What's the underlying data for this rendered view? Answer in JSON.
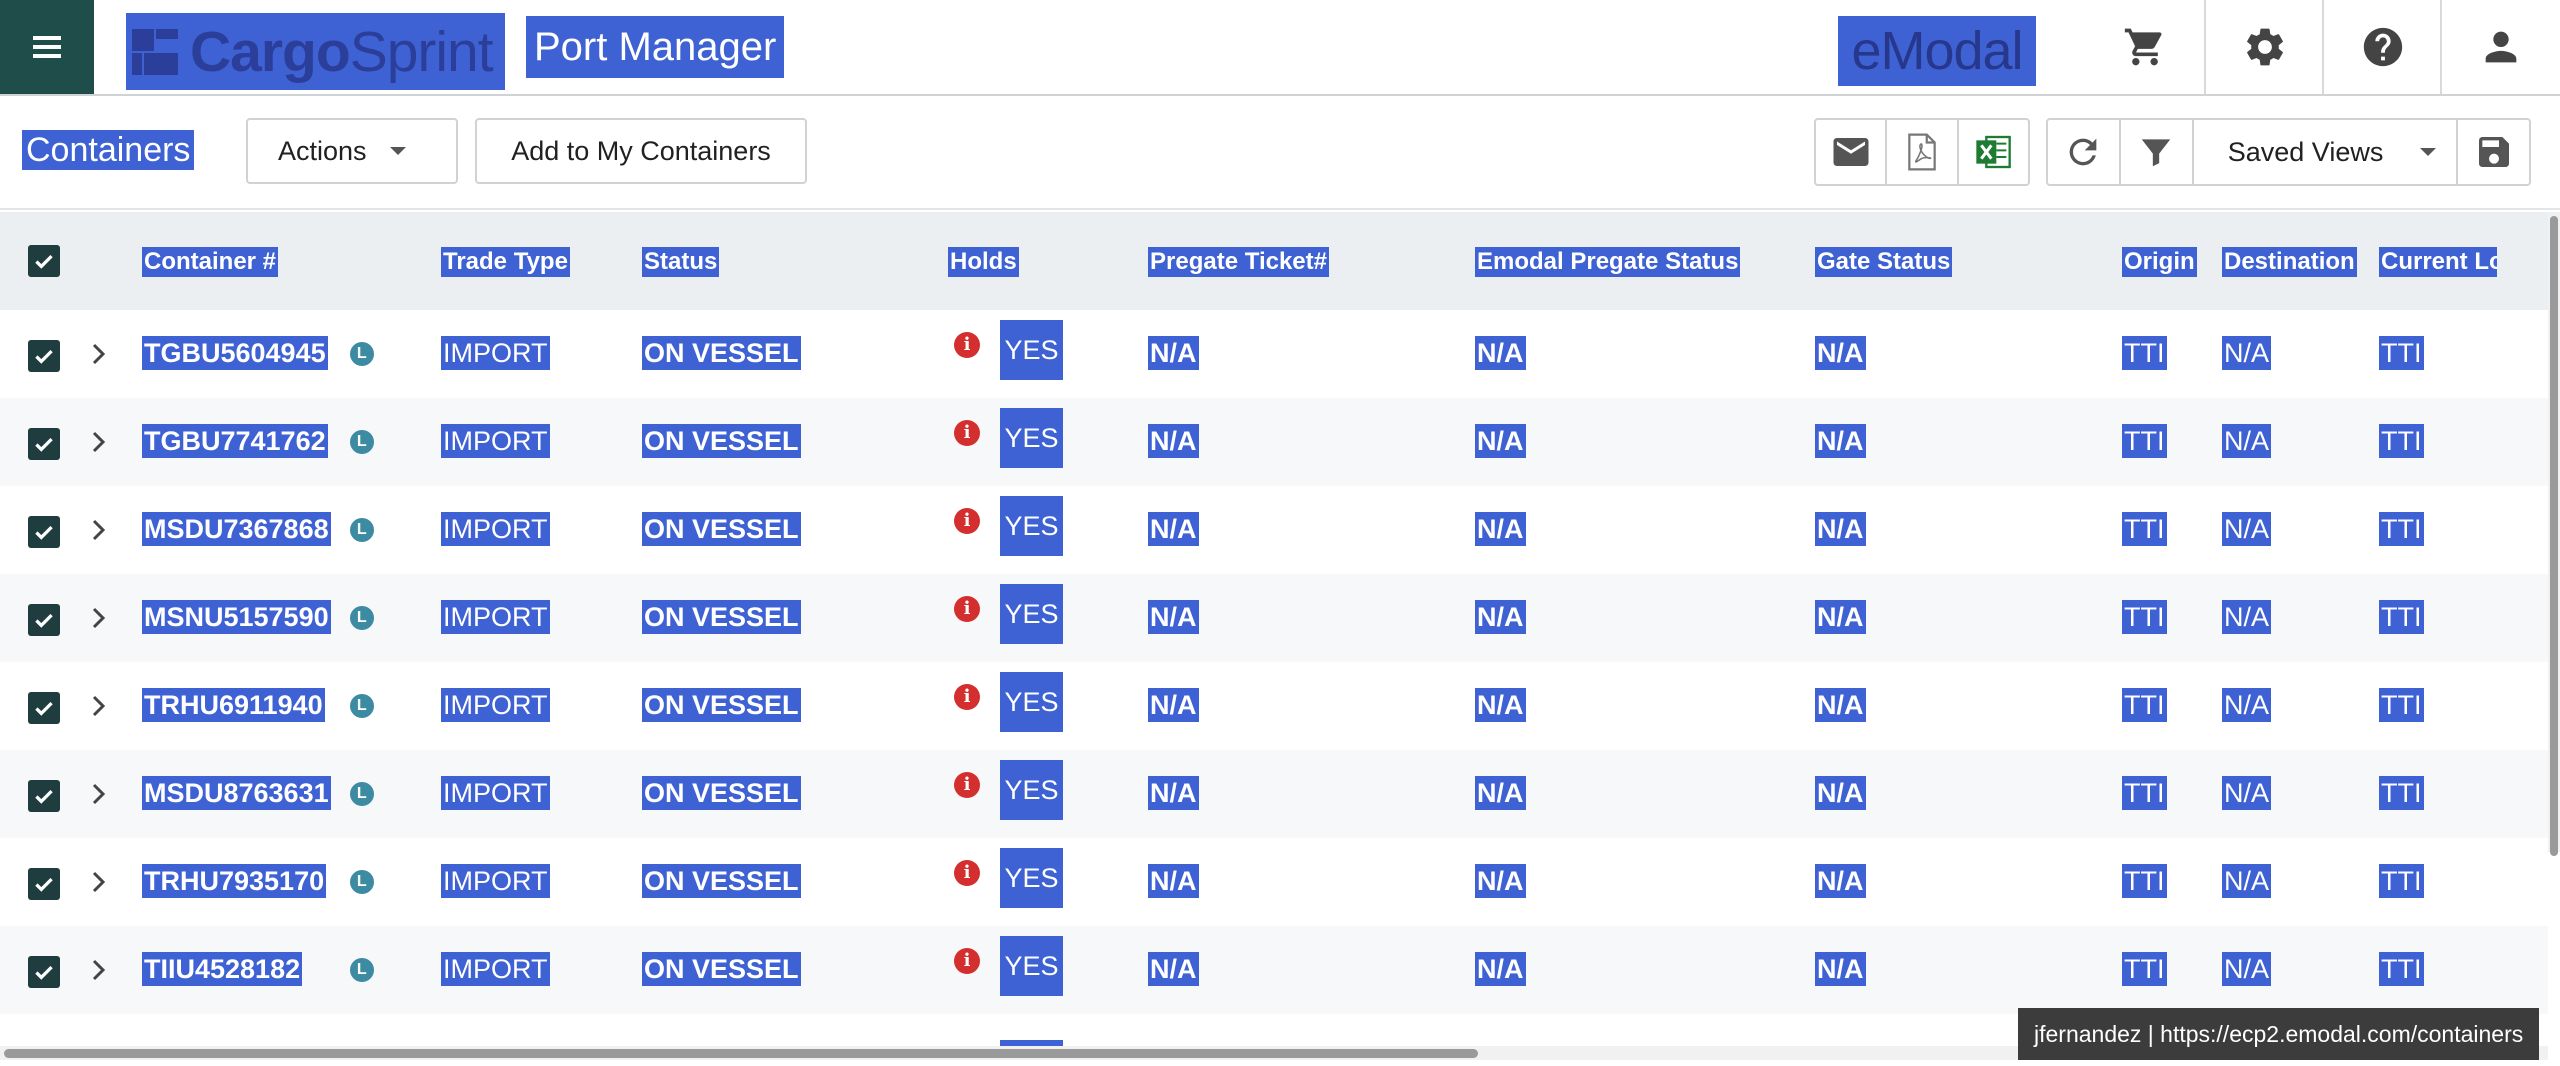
{
  "header": {
    "logo_text": "CargoSprint",
    "app_title": "Port Manager",
    "brand": "eModal",
    "icons": [
      "cart-icon",
      "gear-icon",
      "help-icon",
      "user-icon"
    ]
  },
  "toolbar": {
    "page_title": "Containers",
    "actions_label": "Actions",
    "add_label": "Add to My Containers",
    "saved_views_label": "Saved Views"
  },
  "columns": [
    "Container #",
    "Trade Type",
    "Status",
    "Holds",
    "Pregate Ticket#",
    "Emodal Pregate Status",
    "Gate Status",
    "Origin",
    "Destination",
    "Current Loc"
  ],
  "rows": [
    {
      "container": "TGBU5604945",
      "trade": "IMPORT",
      "status": "ON VESSEL",
      "holds": "YES",
      "pregate": "N/A",
      "emodal_status": "N/A",
      "gate": "N/A",
      "origin": "TTI",
      "destination": "N/A",
      "current": "TTI"
    },
    {
      "container": "TGBU7741762",
      "trade": "IMPORT",
      "status": "ON VESSEL",
      "holds": "YES",
      "pregate": "N/A",
      "emodal_status": "N/A",
      "gate": "N/A",
      "origin": "TTI",
      "destination": "N/A",
      "current": "TTI"
    },
    {
      "container": "MSDU7367868",
      "trade": "IMPORT",
      "status": "ON VESSEL",
      "holds": "YES",
      "pregate": "N/A",
      "emodal_status": "N/A",
      "gate": "N/A",
      "origin": "TTI",
      "destination": "N/A",
      "current": "TTI"
    },
    {
      "container": "MSNU5157590",
      "trade": "IMPORT",
      "status": "ON VESSEL",
      "holds": "YES",
      "pregate": "N/A",
      "emodal_status": "N/A",
      "gate": "N/A",
      "origin": "TTI",
      "destination": "N/A",
      "current": "TTI"
    },
    {
      "container": "TRHU6911940",
      "trade": "IMPORT",
      "status": "ON VESSEL",
      "holds": "YES",
      "pregate": "N/A",
      "emodal_status": "N/A",
      "gate": "N/A",
      "origin": "TTI",
      "destination": "N/A",
      "current": "TTI"
    },
    {
      "container": "MSDU8763631",
      "trade": "IMPORT",
      "status": "ON VESSEL",
      "holds": "YES",
      "pregate": "N/A",
      "emodal_status": "N/A",
      "gate": "N/A",
      "origin": "TTI",
      "destination": "N/A",
      "current": "TTI"
    },
    {
      "container": "TRHU7935170",
      "trade": "IMPORT",
      "status": "ON VESSEL",
      "holds": "YES",
      "pregate": "N/A",
      "emodal_status": "N/A",
      "gate": "N/A",
      "origin": "TTI",
      "destination": "N/A",
      "current": "TTI"
    },
    {
      "container": "TIIU4528182",
      "trade": "IMPORT",
      "status": "ON VESSEL",
      "holds": "YES",
      "pregate": "N/A",
      "emodal_status": "N/A",
      "gate": "N/A",
      "origin": "TTI",
      "destination": "N/A",
      "current": "TTI"
    }
  ],
  "row_badge": "L",
  "footer": {
    "url_tooltip": "jfernandez | https://ecp2.emodal.com/containers"
  },
  "colors": {
    "menu_bg": "#1f4e4a",
    "selection": "#3e62d3",
    "holds_icon": "#d32f2f",
    "excel_green": "#1e7c32",
    "checkbox": "#1f3c3e",
    "badge": "#3d8ba3"
  }
}
